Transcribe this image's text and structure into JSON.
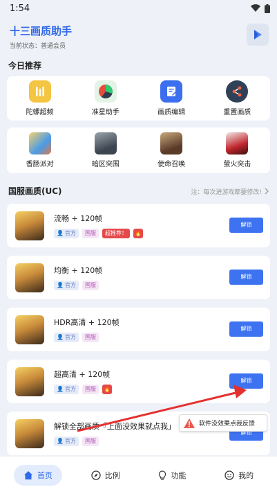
{
  "status_bar": {
    "time": "1:54"
  },
  "header": {
    "title": "十三画质助手",
    "subtitle": "当前状态：普通会员"
  },
  "today": {
    "title": "今日推荐",
    "tools": [
      {
        "label": "陀螺超频",
        "icon": "gyro-icon",
        "color": "#f4c542"
      },
      {
        "label": "准星助手",
        "icon": "crosshair-pie-icon",
        "color": "#e9f5ec"
      },
      {
        "label": "画质编辑",
        "icon": "edit-icon",
        "color": "#3b6ff0"
      },
      {
        "label": "重置画质",
        "icon": "share-icon",
        "color": "#2f4058"
      }
    ],
    "games": [
      {
        "label": "香肠派对"
      },
      {
        "label": "暗区突围"
      },
      {
        "label": "使命召唤"
      },
      {
        "label": "萤火突击"
      }
    ]
  },
  "cn": {
    "title": "国服画质(UC)",
    "hint": "注：每次进游戏都要修改!",
    "items": [
      {
        "title": "流畅 + 120帧",
        "tag_official": "官方",
        "tag_cn": "国服",
        "tag_hot": "超推荐！",
        "fire": true,
        "button": "解锁"
      },
      {
        "title": "均衡 + 120帧",
        "tag_official": "官方",
        "tag_cn": "国服",
        "button": "解锁"
      },
      {
        "title": "HDR高清 + 120帧",
        "tag_official": "官方",
        "tag_cn": "国服",
        "button": "解锁"
      },
      {
        "title": "超高清 + 120帧",
        "tag_official": "官方",
        "tag_cn": "国服",
        "fire": true,
        "button": "解锁"
      },
      {
        "title": "解锁全部画质『上面没效果就点我」",
        "tag_official": "官方",
        "tag_cn": "国服",
        "button": "解锁"
      }
    ]
  },
  "feedback": {
    "label": "软件没效果点我反馈"
  },
  "tabs": [
    {
      "label": "首页",
      "icon": "home-icon",
      "active": true
    },
    {
      "label": "比例",
      "icon": "compass-icon",
      "active": false
    },
    {
      "label": "功能",
      "icon": "bulb-icon",
      "active": false
    },
    {
      "label": "我的",
      "icon": "smile-icon",
      "active": false
    }
  ],
  "colors": {
    "accent": "#3d73f0",
    "hot": "#e44a4a",
    "arrow": "#e53030"
  }
}
